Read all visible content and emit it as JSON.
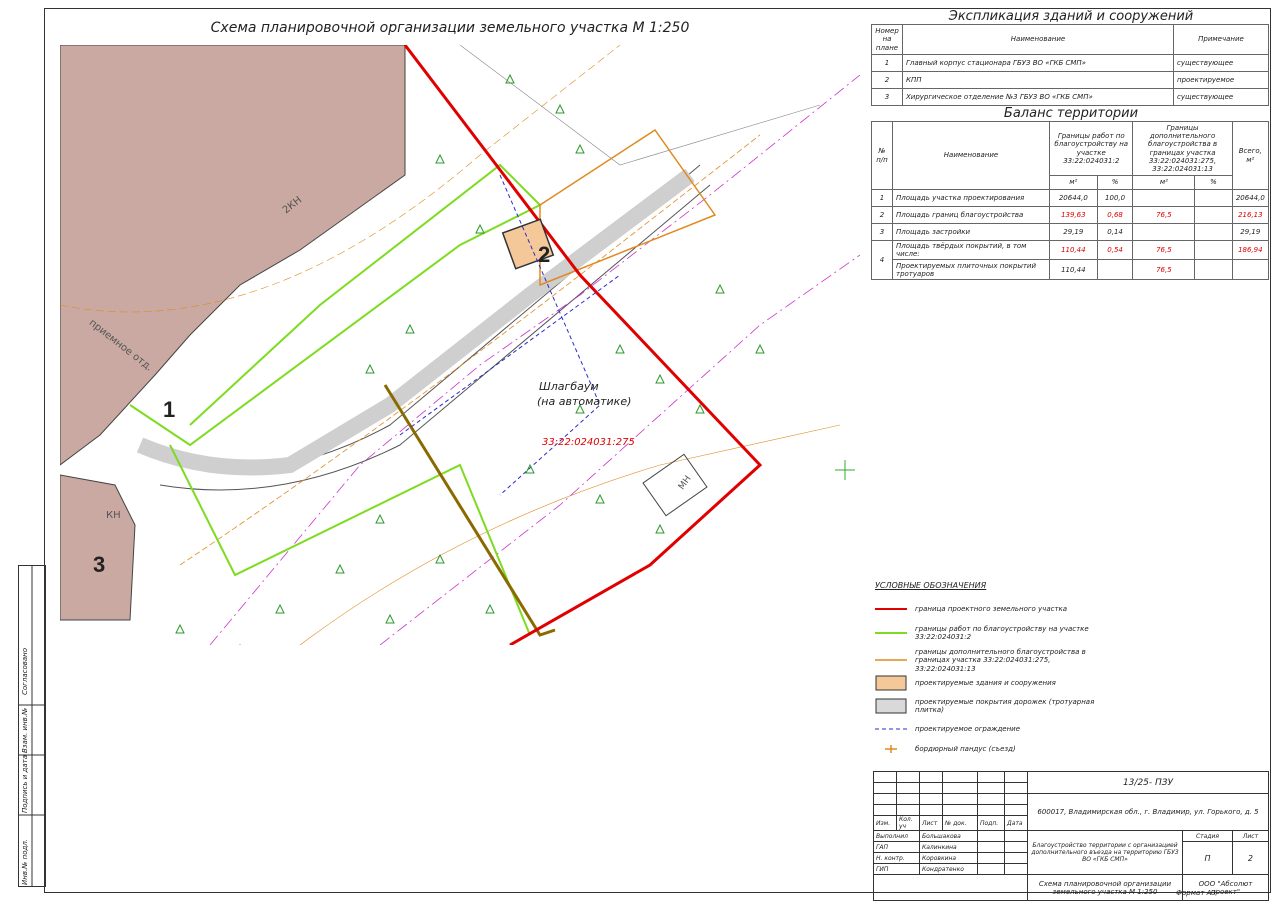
{
  "map": {
    "title": "Схема планировочной организации земельного участка М 1:250",
    "labels": {
      "n1": "1",
      "n2": "2",
      "n3": "3",
      "barrier": "Шлагбаум",
      "barrier_sub": "(на автоматике)",
      "cadastral": "33:22:024031:275",
      "building_kn": "2КН",
      "reception": "приемное отд.",
      "kn": "КН",
      "mn": "МН"
    }
  },
  "explication": {
    "title": "Экспликация зданий и сооружений",
    "headers": [
      "Номер на плане",
      "Наименование",
      "Примечание"
    ],
    "rows": [
      {
        "num": "1",
        "name": "Главный корпус стационара ГБУЗ ВО «ГКБ СМП»",
        "note": "существующее"
      },
      {
        "num": "2",
        "name": "КПП",
        "note": "проектируемое"
      },
      {
        "num": "3",
        "name": "Хирургическое отделение №3 ГБУЗ ВО «ГКБ СМП»",
        "note": "существующее"
      }
    ]
  },
  "balance": {
    "title": "Баланс территории",
    "headers": {
      "num": "№ п/п",
      "name": "Наименование",
      "col1": "Границы работ по благоустройству на участке 33:22:024031:2",
      "col2": "Границы дополнительного благоустройства в границах участка 33:22:024031:275, 33:22:024031:13",
      "total": "Всего, м²",
      "m2": "м²",
      "pct": "%"
    },
    "rows": [
      {
        "num": "1",
        "name": "Площадь участка проектирования",
        "a": "20644,0",
        "b": "100,0",
        "c": "",
        "d": "",
        "total": "20644,0",
        "red": false
      },
      {
        "num": "2",
        "name": "Площадь границ благоустройства",
        "a": "139,63",
        "b": "0,68",
        "c": "76,5",
        "d": "",
        "total": "216,13",
        "red": true
      },
      {
        "num": "3",
        "name": "Площадь застройки",
        "a": "29,19",
        "b": "0,14",
        "c": "",
        "d": "",
        "total": "29,19",
        "red": false
      },
      {
        "num": "4",
        "name": "Площадь твёрдых покрытий, в том числе:",
        "a": "110,44",
        "b": "0,54",
        "c": "76,5",
        "d": "",
        "total": "186,94",
        "red": true
      },
      {
        "num": "",
        "name": "Проектируемых плиточных покрытий тротуаров",
        "a": "110,44",
        "b": "",
        "c": "76,5",
        "d": "",
        "total": "",
        "red": false
      }
    ]
  },
  "legend": {
    "title": "УСЛОВНЫЕ ОБОЗНАЧЕНИЯ",
    "items": [
      {
        "text": "граница проектного земельного участка",
        "color": "#e00000"
      },
      {
        "text": "границы работ по благоустройству на участке 33:22:024031:2",
        "color": "#7ddc1f"
      },
      {
        "text": "границы дополнительного благоустройства в границах участка 33:22:024031:275, 33:22:024031:13",
        "color": "#e08a1e"
      },
      {
        "text": "проектируемые здания и сооружения",
        "color": "#f5c89a"
      },
      {
        "text": "проектируемые покрытия дорожек (тротуарная плитка)",
        "color": "#d9d9d9"
      },
      {
        "text": "проектируемое ограждение",
        "color": "#2b2bcc"
      },
      {
        "text": "бордюрный пандус (съезд)",
        "color": "#e08a1e"
      }
    ]
  },
  "stamp": {
    "code": "13/25- ПЗУ",
    "address": "600017, Владимирская обл., г. Владимир, ул. Горького, д. 5",
    "headers": [
      "Изм.",
      "Кол. уч",
      "Лист",
      "№ док.",
      "Подп.",
      "Дата"
    ],
    "roles": [
      "Выполнил",
      "ГАП",
      "Н. контр.",
      "ГИП"
    ],
    "names": [
      "Большакова",
      "Калинкина",
      "Коровкина",
      "Кондратенко"
    ],
    "project": "Благоустройство территории с организацией дополнительного въезда на территорию ГБУЗ ВО «ГКБ СМП»",
    "stage_h": "Стадия",
    "sheet_h": "Лист",
    "sheets_h": "Листов",
    "stage": "П",
    "sheet": "2",
    "sheets": "",
    "drawing": "Схема планировочной организации земельного участка М 1:250",
    "company": "ООО \"Абсолют проект\"",
    "format": "Формат А3"
  },
  "side_stamp": {
    "agreed": "Согласовано",
    "inv_replace": "Взам. инв.№",
    "sign_date": "Подпись и дата",
    "inv_orig": "Инв.№ подл."
  }
}
